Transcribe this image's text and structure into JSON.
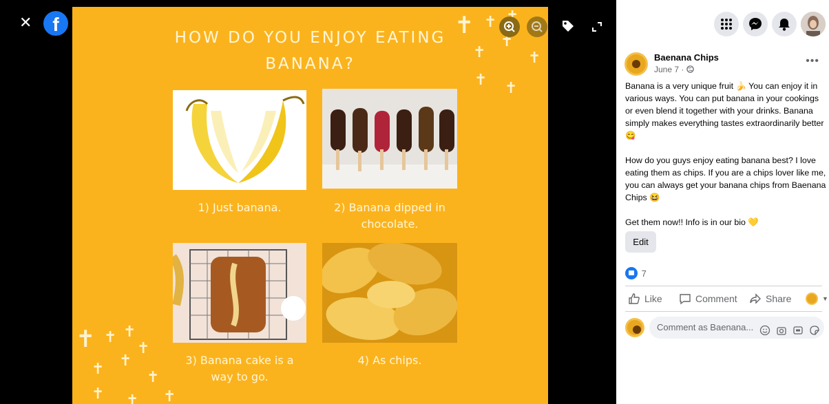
{
  "viewer": {
    "poster": {
      "title_line1": "HOW DO YOU ENJOY EATING",
      "title_line2": "BANANA?",
      "captions": [
        {
          "line1": "1) Just banana.",
          "line2": ""
        },
        {
          "line1": "2) Banana dipped in",
          "line2": "chocolate."
        },
        {
          "line1": "3) Banana cake is a",
          "line2": "way to go."
        },
        {
          "line1": "4) As chips.",
          "line2": ""
        }
      ]
    },
    "icons": {
      "close": "close-icon",
      "facebook": "facebook-logo",
      "zoom_in": "zoom-in-icon",
      "zoom_out": "zoom-out-icon",
      "tag": "tag-icon",
      "fullscreen": "fullscreen-icon"
    }
  },
  "header": {
    "icons": [
      "menu-grid-icon",
      "messenger-icon",
      "notifications-bell-icon",
      "profile-avatar"
    ]
  },
  "post": {
    "page_name": "Baenana Chips",
    "date": "June 7 · ",
    "paragraphs": [
      "Banana is a very unique fruit 🍌 You can enjoy it in various ways. You can put banana in your cookings or even blend it together with your drinks. Banana simply makes everything tastes extraordinarily better 😋",
      "How do you guys enjoy eating banana best? I love eating them as chips. If you are a chips lover like me, you can always get your banana chips from Baenana Chips 😆",
      "Get them now!! Info is in our bio 💛"
    ],
    "edit_label": "Edit",
    "reaction_count": "7",
    "actions": {
      "like": "Like",
      "comment": "Comment",
      "share": "Share"
    },
    "comment_placeholder": "Comment as Baenana..."
  },
  "colors": {
    "poster_bg": "#FBB31D",
    "accent": "#1877F2"
  }
}
